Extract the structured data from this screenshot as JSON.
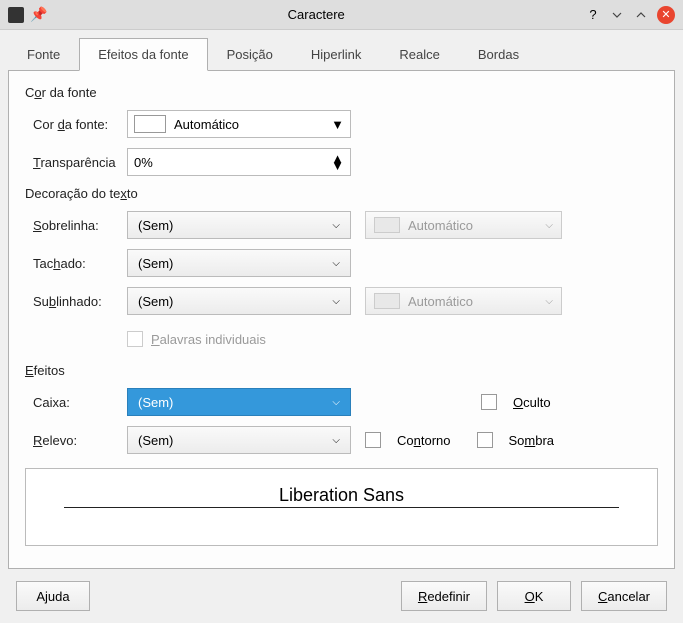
{
  "window": {
    "title": "Caractere"
  },
  "tabs": [
    "Fonte",
    "Efeitos da fonte",
    "Posição",
    "Hiperlink",
    "Realce",
    "Bordas"
  ],
  "sections": {
    "cor": {
      "header_pre": "C",
      "header_u": "o",
      "header_post": "r da fonte",
      "font_color_label": "Cor ",
      "font_color_u": "d",
      "font_color_post": "a fonte:",
      "font_color_value": "Automático",
      "transp_u": "T",
      "transp_post": "ransparência",
      "transp_value": "0%"
    },
    "deco": {
      "header_pre": "Decoração do te",
      "header_u": "x",
      "header_post": "to",
      "overline_u": "S",
      "overline_post": "obrelinha:",
      "overline_value": "(Sem)",
      "overline_color": "Automático",
      "strike_pre": "Tac",
      "strike_u": "h",
      "strike_post": "ado:",
      "strike_value": "(Sem)",
      "under_pre": "Su",
      "under_u": "b",
      "under_post": "linhado:",
      "under_value": "(Sem)",
      "under_color": "Automático",
      "words_u": "P",
      "words_post": "alavras individuais"
    },
    "efeitos": {
      "header_u": "E",
      "header_post": "feitos",
      "caixa_label": "Caixa:",
      "caixa_value": "(Sem)",
      "relevo_u": "R",
      "relevo_post": "elevo:",
      "relevo_value": "(Sem)",
      "oculto_u": "O",
      "oculto_post": "culto",
      "contorno_pre": "Co",
      "contorno_u": "n",
      "contorno_post": "torno",
      "sombra_pre": "So",
      "sombra_u": "m",
      "sombra_post": "bra"
    }
  },
  "preview": {
    "text": "Liberation Sans"
  },
  "buttons": {
    "help": "Ajuda",
    "help_u": "j",
    "reset": "Redefinir",
    "reset_u": "R",
    "ok": "OK",
    "ok_u": "O",
    "cancel": "Cancelar",
    "cancel_u": "C"
  }
}
